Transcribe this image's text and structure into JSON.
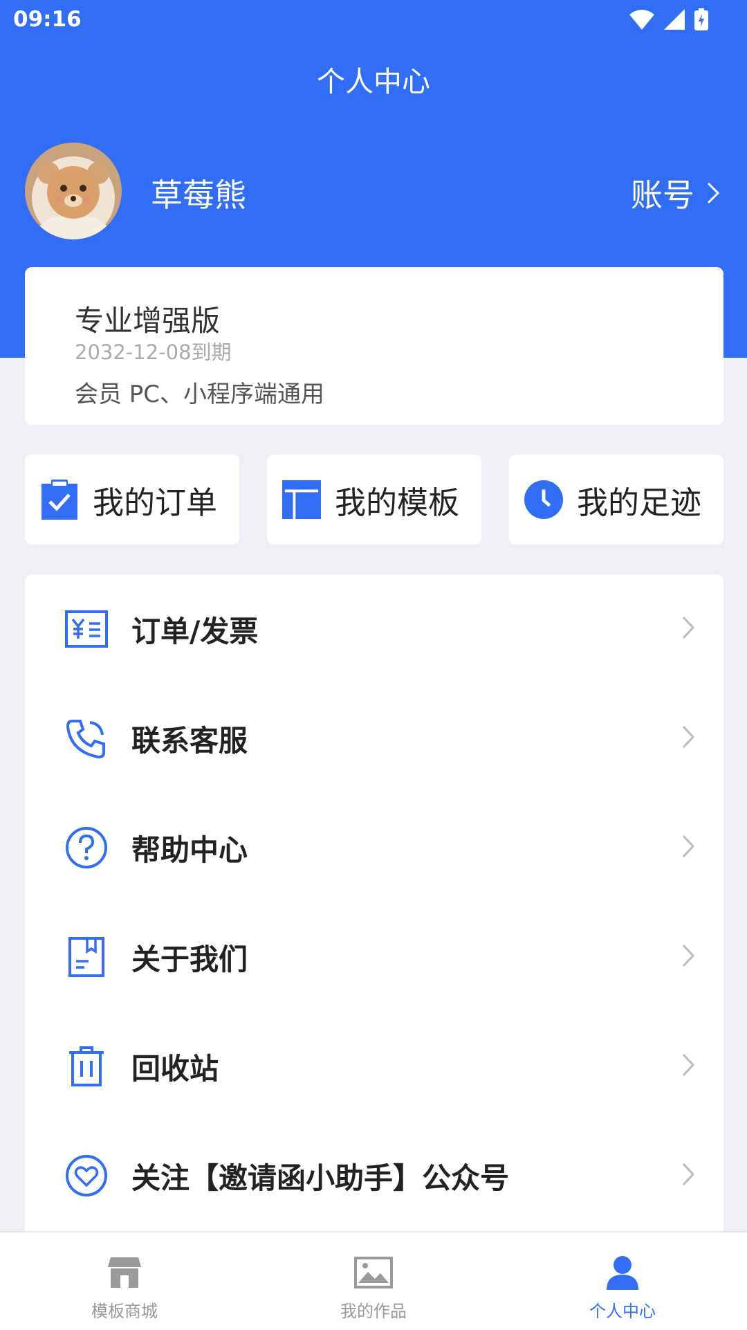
{
  "status_bar": {
    "time": "09:16"
  },
  "header": {
    "title": "个人中心"
  },
  "profile": {
    "username": "草莓熊",
    "account_label": "账号"
  },
  "membership": {
    "title": "专业增强版",
    "expire": "2032-12-08到期",
    "desc": "会员 PC、小程序端通用"
  },
  "quick": [
    {
      "label": "我的订单",
      "icon": "clipboard-check-icon"
    },
    {
      "label": "我的模板",
      "icon": "template-layout-icon"
    },
    {
      "label": "我的足迹",
      "icon": "clock-icon"
    }
  ],
  "menu": [
    {
      "label": "订单/发票",
      "icon": "invoice-icon"
    },
    {
      "label": "联系客服",
      "icon": "phone-icon"
    },
    {
      "label": "帮助中心",
      "icon": "help-icon"
    },
    {
      "label": "关于我们",
      "icon": "about-icon"
    },
    {
      "label": "回收站",
      "icon": "trash-icon"
    },
    {
      "label": "关注【邀请函小助手】公众号",
      "icon": "heart-icon"
    }
  ],
  "tabbar": [
    {
      "label": "模板商城",
      "icon": "store-icon",
      "active": false
    },
    {
      "label": "我的作品",
      "icon": "image-icon",
      "active": false
    },
    {
      "label": "个人中心",
      "icon": "user-icon",
      "active": true
    }
  ],
  "colors": {
    "primary": "#316ef5",
    "background": "#eef0f5"
  }
}
